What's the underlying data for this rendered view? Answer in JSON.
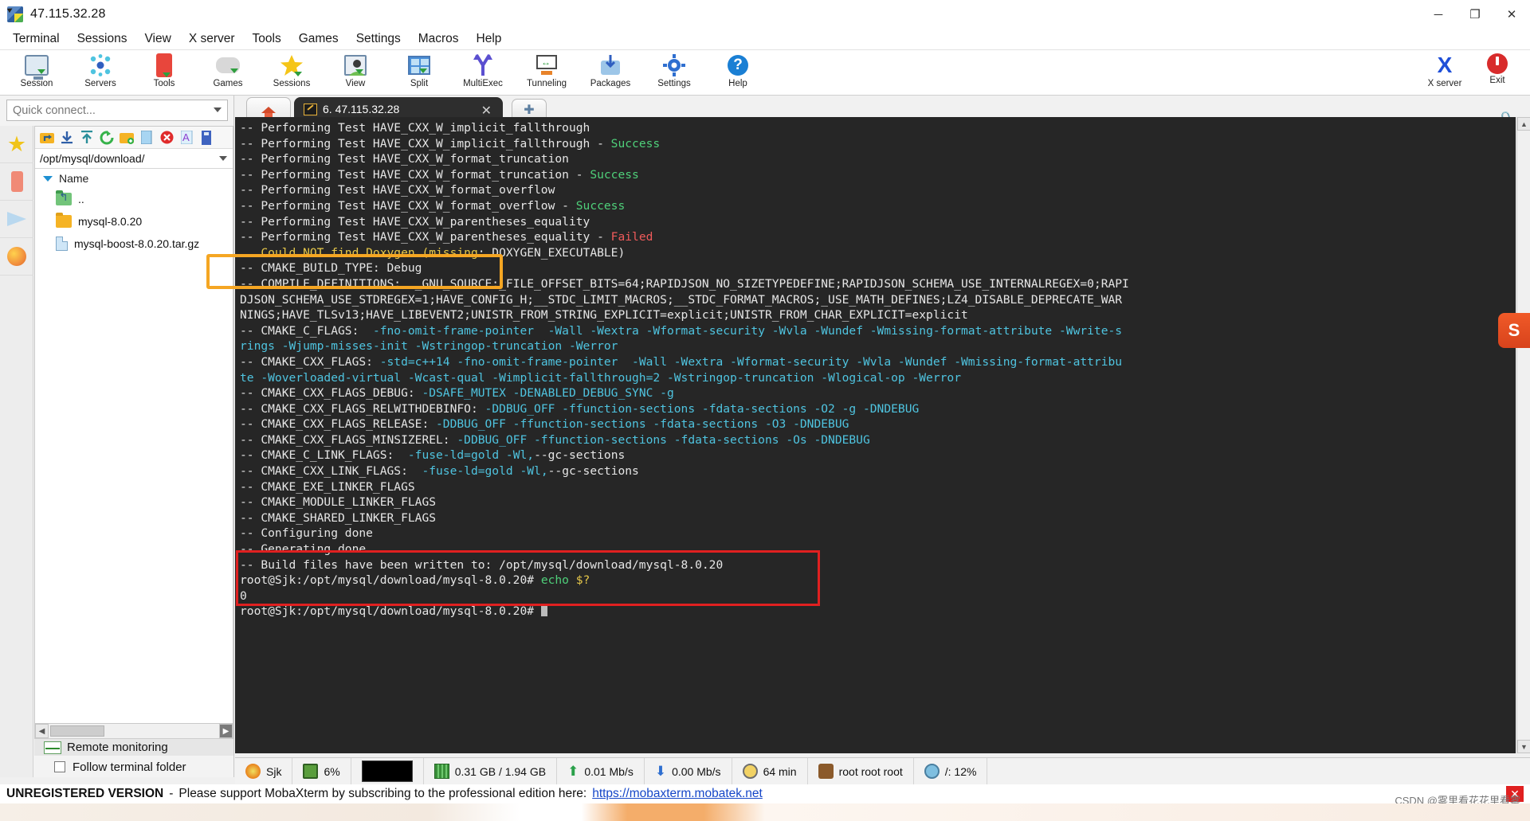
{
  "window": {
    "title": "47.115.32.28",
    "minimize": "─",
    "maximize": "❐",
    "close": "✕"
  },
  "menubar": {
    "items": [
      "Terminal",
      "Sessions",
      "View",
      "X server",
      "Tools",
      "Games",
      "Settings",
      "Macros",
      "Help"
    ]
  },
  "ribbon": {
    "items": [
      {
        "label": "Session",
        "icon": "session-icon"
      },
      {
        "label": "Servers",
        "icon": "servers-icon"
      },
      {
        "label": "Tools",
        "icon": "tools-icon"
      },
      {
        "label": "Games",
        "icon": "games-icon"
      },
      {
        "label": "Sessions",
        "icon": "sessions-star-icon"
      },
      {
        "label": "View",
        "icon": "view-icon"
      },
      {
        "label": "Split",
        "icon": "split-icon"
      },
      {
        "label": "MultiExec",
        "icon": "multiexec-icon"
      },
      {
        "label": "Tunneling",
        "icon": "tunneling-icon"
      },
      {
        "label": "Packages",
        "icon": "packages-icon"
      },
      {
        "label": "Settings",
        "icon": "settings-gear-icon"
      },
      {
        "label": "Help",
        "icon": "help-icon"
      }
    ],
    "right": [
      {
        "label": "X server",
        "icon": "x-server-icon"
      },
      {
        "label": "Exit",
        "icon": "power-exit-icon"
      }
    ]
  },
  "sidebar": {
    "quick_connect_placeholder": "Quick connect...",
    "buttons": [
      "favorites-star-icon",
      "tools-icon",
      "sftp-plane-icon",
      "globe-icon"
    ],
    "path": "/opt/mysql/download/",
    "column_header": "Name",
    "files": [
      {
        "name": "..",
        "type": "parent-folder"
      },
      {
        "name": "mysql-8.0.20",
        "type": "folder"
      },
      {
        "name": "mysql-boost-8.0.20.tar.gz",
        "type": "file"
      }
    ],
    "remote_monitoring": "Remote monitoring",
    "follow_terminal_folder": "Follow terminal folder",
    "follow_checked": false
  },
  "tabs": {
    "home_icon": "home-icon",
    "active": "6. 47.115.32.28",
    "close_glyph": "✕",
    "new_tab_glyph": "✚"
  },
  "terminal": {
    "lines": [
      [
        {
          "t": "-- Performing Test HAVE_CXX_W_implicit_fallthrough",
          "c": "w"
        }
      ],
      [
        {
          "t": "-- Performing Test HAVE_CXX_W_implicit_fallthrough - ",
          "c": "w"
        },
        {
          "t": "Success",
          "c": "g"
        }
      ],
      [
        {
          "t": "-- Performing Test HAVE_CXX_W_format_truncation",
          "c": "w"
        }
      ],
      [
        {
          "t": "-- Performing Test HAVE_CXX_W_format_truncation - ",
          "c": "w"
        },
        {
          "t": "Success",
          "c": "g"
        }
      ],
      [
        {
          "t": "-- Performing Test HAVE_CXX_W_format_overflow",
          "c": "w"
        }
      ],
      [
        {
          "t": "-- Performing Test HAVE_CXX_W_format_overflow - ",
          "c": "w"
        },
        {
          "t": "Success",
          "c": "g"
        }
      ],
      [
        {
          "t": "-- Performing Test HAVE_CXX_W_parentheses_equality",
          "c": "w"
        }
      ],
      [
        {
          "t": "-- Performing Test HAVE_CXX_W_parentheses_equality - ",
          "c": "w"
        },
        {
          "t": "Failed",
          "c": "r"
        }
      ],
      [
        {
          "t": "   Could NOT find Doxygen (missing",
          "c": "y"
        },
        {
          "t": ": DOXYGEN_EXECUTABLE)",
          "c": "w"
        }
      ],
      [
        {
          "t": "-- CMAKE_BUILD_TYPE: Debug",
          "c": "w"
        }
      ],
      [
        {
          "t": "-- COMPILE_DEFINITIONS:  _GNU_SOURCE;_FILE_OFFSET_BITS=64;RAPIDJSON_NO_SIZETYPEDEFINE;RAPIDJSON_SCHEMA_USE_INTERNALREGEX=0;RAPI",
          "c": "w"
        }
      ],
      [
        {
          "t": "DJSON_SCHEMA_USE_STDREGEX=1;HAVE_CONFIG_H;__STDC_LIMIT_MACROS;__STDC_FORMAT_MACROS;_USE_MATH_DEFINES;LZ4_DISABLE_DEPRECATE_WAR",
          "c": "w"
        }
      ],
      [
        {
          "t": "NINGS;HAVE_TLSv13;HAVE_LIBEVENT2;UNISTR_FROM_STRING_EXPLICIT=explicit;UNISTR_FROM_CHAR_EXPLICIT=explicit",
          "c": "w"
        }
      ],
      [
        {
          "t": "-- CMAKE_C_FLAGS: ",
          "c": "w"
        },
        {
          "t": " -fno-omit-frame-pointer",
          "c": "c"
        },
        {
          "t": "  ",
          "c": "w"
        },
        {
          "t": "-Wall -Wextra -Wformat-security -Wvla -Wundef -Wmissing-format-attribute -Wwrite-s",
          "c": "c"
        }
      ],
      [
        {
          "t": "rings ",
          "c": "c"
        },
        {
          "t": "-Wjump-misses-init -Wstringop-truncation -Werror",
          "c": "c"
        }
      ],
      [
        {
          "t": "-- CMAKE_CXX_FLAGS: ",
          "c": "w"
        },
        {
          "t": "-std=c++14 -fno-omit-frame-pointer",
          "c": "c"
        },
        {
          "t": "  ",
          "c": "w"
        },
        {
          "t": "-Wall -Wextra -Wformat-security -Wvla -Wundef -Wmissing-format-attribu",
          "c": "c"
        }
      ],
      [
        {
          "t": "te -Woverloaded-virtual -Wcast-qual -Wimplicit-fallthrough=2 -Wstringop-truncation -Wlogical-op -Werror",
          "c": "c"
        }
      ],
      [
        {
          "t": "-- CMAKE_CXX_FLAGS_DEBUG: ",
          "c": "w"
        },
        {
          "t": "-DSAFE_MUTEX -DENABLED_DEBUG_SYNC -g",
          "c": "c"
        }
      ],
      [
        {
          "t": "-- CMAKE_CXX_FLAGS_RELWITHDEBINFO: ",
          "c": "w"
        },
        {
          "t": "-DDBUG_OFF -ffunction-sections -fdata-sections -O2 -g -DNDEBUG",
          "c": "c"
        }
      ],
      [
        {
          "t": "-- CMAKE_CXX_FLAGS_RELEASE: ",
          "c": "w"
        },
        {
          "t": "-DDBUG_OFF -ffunction-sections -fdata-sections -O3 -DNDEBUG",
          "c": "c"
        }
      ],
      [
        {
          "t": "-- CMAKE_CXX_FLAGS_MINSIZEREL: ",
          "c": "w"
        },
        {
          "t": "-DDBUG_OFF -ffunction-sections -fdata-sections -Os -DNDEBUG",
          "c": "c"
        }
      ],
      [
        {
          "t": "-- CMAKE_C_LINK_FLAGS: ",
          "c": "w"
        },
        {
          "t": " -fuse-ld=gold",
          "c": "c"
        },
        {
          "t": " ",
          "c": "w"
        },
        {
          "t": "-Wl,",
          "c": "c"
        },
        {
          "t": "--gc-sections",
          "c": "w"
        }
      ],
      [
        {
          "t": "-- CMAKE_CXX_LINK_FLAGS: ",
          "c": "w"
        },
        {
          "t": " -fuse-ld=gold",
          "c": "c"
        },
        {
          "t": " ",
          "c": "w"
        },
        {
          "t": "-Wl,",
          "c": "c"
        },
        {
          "t": "--gc-sections",
          "c": "w"
        }
      ],
      [
        {
          "t": "-- CMAKE_EXE_LINKER_FLAGS",
          "c": "w"
        }
      ],
      [
        {
          "t": "-- CMAKE_MODULE_LINKER_FLAGS",
          "c": "w"
        }
      ],
      [
        {
          "t": "-- CMAKE_SHARED_LINKER_FLAGS",
          "c": "w"
        }
      ],
      [
        {
          "t": "-- Configuring done",
          "c": "w"
        }
      ],
      [
        {
          "t": "-- Generating done",
          "c": "w"
        }
      ],
      [
        {
          "t": "-- Build files have been written to: /opt/mysql/download/mysql-8.0.20",
          "c": "w"
        }
      ],
      [
        {
          "t": "root@Sjk:/opt/mysql/download/mysql-8.0.20# ",
          "c": "w"
        },
        {
          "t": "echo",
          "c": "g"
        },
        {
          "t": " ",
          "c": "w"
        },
        {
          "t": "$?",
          "c": "y"
        }
      ],
      [
        {
          "t": "0",
          "c": "w"
        }
      ],
      [
        {
          "t": "root@Sjk:/opt/mysql/download/mysql-8.0.20# ",
          "c": "w"
        }
      ]
    ]
  },
  "statusbar": {
    "items": [
      {
        "label": "Sjk",
        "icon": "host-icon"
      },
      {
        "label": "6%",
        "icon": "cpu-icon"
      },
      {
        "label": "",
        "icon": "activity-graph-icon"
      },
      {
        "label": "0.31 GB / 1.94 GB",
        "icon": "ram-icon"
      },
      {
        "label": "0.01 Mb/s",
        "icon": "upload-icon"
      },
      {
        "label": "0.00 Mb/s",
        "icon": "download-icon"
      },
      {
        "label": "64 min",
        "icon": "uptime-clock-icon"
      },
      {
        "label": "root root root",
        "icon": "user-icon"
      },
      {
        "label": "/: 12%",
        "icon": "disk-icon"
      }
    ]
  },
  "footer": {
    "unregistered": "UNREGISTERED VERSION",
    "dash": "-",
    "message": "Please support MobaXterm by subscribing to the professional edition here:",
    "link": "https://mobaxterm.mobatek.net",
    "close_glyph": "✕",
    "watermark": "CSDN @雾里看花花里看雾"
  },
  "colors": {
    "terminal_bg": "#262626",
    "success": "#4fd07a",
    "failed": "#f05b5b",
    "warning": "#e8c94a",
    "flags": "#4fc4e0",
    "annotation_orange": "#f5a623",
    "annotation_red": "#e02020",
    "link": "#1546c8"
  }
}
